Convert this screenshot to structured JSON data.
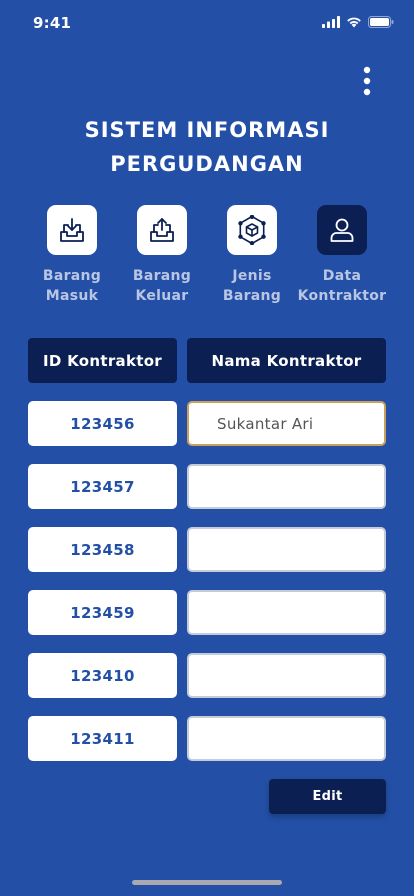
{
  "status_bar": {
    "time": "9:41",
    "icons": [
      "signal-icon",
      "wifi-icon",
      "battery-icon"
    ]
  },
  "header": {
    "title_line1": "SISTEM INFORMASI",
    "title_line2": "PERGUDANGAN",
    "more_icon": "kebab-menu-icon"
  },
  "menu": [
    {
      "line1": "Barang",
      "line2": "Masuk",
      "icon": "inbox-download-icon",
      "active": false
    },
    {
      "line1": "Barang",
      "line2": "Keluar",
      "icon": "inbox-upload-icon",
      "active": false
    },
    {
      "line1": "Jenis",
      "line2": "Barang",
      "icon": "cube-network-icon",
      "active": false
    },
    {
      "line1": "Data",
      "line2": "Kontraktor",
      "icon": "user-icon",
      "active": true
    }
  ],
  "table": {
    "headers": {
      "id": "ID Kontraktor",
      "name": "Nama Kontraktor"
    },
    "rows": [
      {
        "id": "123456",
        "name": "Sukantar Ari"
      },
      {
        "id": "123457",
        "name": ""
      },
      {
        "id": "123458",
        "name": ""
      },
      {
        "id": "123459",
        "name": ""
      },
      {
        "id": "123410",
        "name": ""
      },
      {
        "id": "123411",
        "name": ""
      }
    ]
  },
  "edit_label": "Edit",
  "colors": {
    "background": "#2350a6",
    "dark_navy": "#0c1f52",
    "white": "#ffffff",
    "focus_border": "#c9a15a"
  }
}
